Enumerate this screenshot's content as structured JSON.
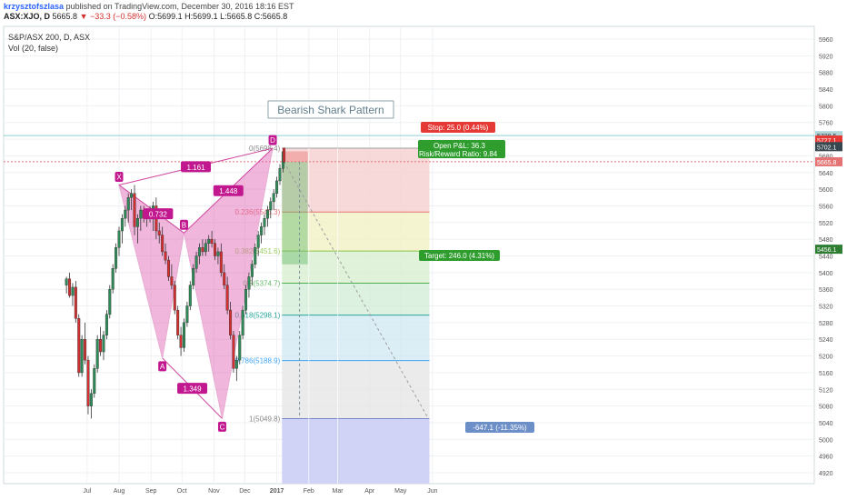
{
  "header": {
    "author": "krzysztofszlasa",
    "published_text": "published on TradingView.com, December 30, 2016 18:16 EST",
    "symbol": "ASX:XJO, D",
    "last": "5665.8",
    "change": "−33.3 (−0.58%)",
    "o": "O:5699.1",
    "h": "H:5699.1",
    "l": "L:5665.8",
    "c": "C:5665.8"
  },
  "legend": {
    "line1": "S&P/ASX 200, D, ASX",
    "line2": "Vol (20, false)"
  },
  "chart_data": {
    "type": "candlestick",
    "title": "Bearish Shark Pattern",
    "x_ticks": [
      "Jul",
      "Aug",
      "Sep",
      "Oct",
      "Nov",
      "Dec",
      "2017",
      "Feb",
      "Mar",
      "Apr",
      "May",
      "Jun"
    ],
    "y_ticks": [
      4920,
      4960,
      5000,
      5040,
      5080,
      5120,
      5160,
      5200,
      5240,
      5280,
      5320,
      5360,
      5400,
      5440,
      5480,
      5520,
      5560,
      5600,
      5640,
      5680,
      5720,
      5760,
      5800,
      5840,
      5880,
      5920,
      5960
    ],
    "ylim": [
      4900,
      5980
    ],
    "pattern_points": [
      {
        "label": "X",
        "date": "2016-08-01",
        "price": 5610
      },
      {
        "label": "A",
        "date": "2016-09-12",
        "price": 5195
      },
      {
        "label": "B",
        "date": "2016-10-03",
        "price": 5495
      },
      {
        "label": "C",
        "date": "2016-11-09",
        "price": 5050
      },
      {
        "label": "D",
        "date": "2016-12-28",
        "price": 5698
      }
    ],
    "ratios": [
      {
        "text": "0.732",
        "between": "X-B"
      },
      {
        "text": "1.161",
        "between": "X-D"
      },
      {
        "text": "1.448",
        "between": "B-D"
      },
      {
        "text": "1.349",
        "between": "A-C"
      }
    ],
    "fib_levels": [
      {
        "label": "0(5698.4)",
        "price": 5698.4
      },
      {
        "label": "0.236(5545.3)",
        "price": 5545.3
      },
      {
        "label": "0.382(5451.6)",
        "price": 5451.6
      },
      {
        "label": "0.5(5374.7)",
        "price": 5374.7
      },
      {
        "label": "0.618(5298.1)",
        "price": 5298.1
      },
      {
        "label": "0.786(5188.9)",
        "price": 5188.9
      },
      {
        "label": "1(5049.8)",
        "price": 5049.8
      }
    ],
    "trade": {
      "stop": "Stop: 25.0 (0.44%)",
      "open_pl": "Open P&L: 36.3",
      "risk_reward": "Risk/Reward Ratio: 9.84",
      "target": "Target: 246.0 (4.31%)",
      "measure": "-647.1 (-11.35%)",
      "entry_price": 5665.8,
      "stop_price": 5690.8,
      "target_price": 5419.8
    },
    "price_labels": [
      {
        "text": "5728.5",
        "price": 5728.5,
        "color": "#b0d4d8"
      },
      {
        "text": "5727.1",
        "price": 5718,
        "color": "#e53935"
      },
      {
        "text": "5702.1",
        "price": 5702,
        "color": "#37474f"
      },
      {
        "text": "5665.8",
        "price": 5665.8,
        "color": "#e57373"
      },
      {
        "text": "5456.1",
        "price": 5456.1,
        "color": "#2e7d32"
      }
    ],
    "candles": [
      [
        -51,
        5370,
        5390,
        5350,
        5385
      ],
      [
        -48,
        5385,
        5400,
        5340,
        5345
      ],
      [
        -45,
        5345,
        5375,
        5320,
        5365
      ],
      [
        -42,
        5365,
        5380,
        5280,
        5290
      ],
      [
        -39,
        5290,
        5300,
        5150,
        5160
      ],
      [
        -36,
        5160,
        5250,
        5150,
        5240
      ],
      [
        -33,
        5240,
        5280,
        5180,
        5190
      ],
      [
        -30,
        5190,
        5200,
        5060,
        5080
      ],
      [
        -27,
        5080,
        5120,
        5050,
        5110
      ],
      [
        -24,
        5110,
        5180,
        5100,
        5170
      ],
      [
        -21,
        5170,
        5250,
        5160,
        5240
      ],
      [
        -18,
        5240,
        5270,
        5200,
        5210
      ],
      [
        -15,
        5210,
        5260,
        5190,
        5250
      ],
      [
        -12,
        5250,
        5310,
        5240,
        5300
      ],
      [
        -9,
        5300,
        5370,
        5290,
        5360
      ],
      [
        -6,
        5360,
        5420,
        5350,
        5410
      ],
      [
        -3,
        5410,
        5470,
        5400,
        5460
      ],
      [
        0,
        5460,
        5510,
        5440,
        5500
      ],
      [
        3,
        5500,
        5540,
        5470,
        5530
      ],
      [
        6,
        5530,
        5560,
        5510,
        5550
      ],
      [
        9,
        5550,
        5590,
        5520,
        5580
      ],
      [
        12,
        5580,
        5600,
        5550,
        5590
      ],
      [
        15,
        5590,
        5610,
        5490,
        5510
      ],
      [
        18,
        5510,
        5540,
        5470,
        5530
      ],
      [
        21,
        5530,
        5560,
        5500,
        5550
      ],
      [
        24,
        5550,
        5560,
        5520,
        5530
      ],
      [
        27,
        5530,
        5550,
        5510,
        5540
      ],
      [
        30,
        5540,
        5560,
        5520,
        5530
      ],
      [
        33,
        5530,
        5570,
        5500,
        5560
      ],
      [
        36,
        5560,
        5580,
        5480,
        5500
      ],
      [
        39,
        5500,
        5520,
        5470,
        5490
      ],
      [
        42,
        5490,
        5510,
        5440,
        5450
      ],
      [
        45,
        5450,
        5470,
        5420,
        5430
      ],
      [
        48,
        5430,
        5440,
        5380,
        5390
      ],
      [
        51,
        5390,
        5420,
        5360,
        5370
      ],
      [
        54,
        5370,
        5380,
        5300,
        5310
      ],
      [
        57,
        5310,
        5320,
        5240,
        5250
      ],
      [
        60,
        5250,
        5270,
        5200,
        5220
      ],
      [
        63,
        5220,
        5290,
        5210,
        5280
      ],
      [
        66,
        5280,
        5330,
        5270,
        5320
      ],
      [
        69,
        5320,
        5380,
        5310,
        5370
      ],
      [
        72,
        5370,
        5420,
        5360,
        5410
      ],
      [
        75,
        5410,
        5450,
        5400,
        5440
      ],
      [
        78,
        5440,
        5470,
        5420,
        5460
      ],
      [
        81,
        5460,
        5480,
        5440,
        5450
      ],
      [
        84,
        5450,
        5480,
        5440,
        5470
      ],
      [
        87,
        5470,
        5490,
        5450,
        5480
      ],
      [
        90,
        5480,
        5500,
        5460,
        5470
      ],
      [
        93,
        5470,
        5480,
        5430,
        5440
      ],
      [
        96,
        5440,
        5460,
        5420,
        5450
      ],
      [
        99,
        5450,
        5470,
        5390,
        5400
      ],
      [
        102,
        5400,
        5420,
        5360,
        5370
      ],
      [
        105,
        5370,
        5390,
        5300,
        5310
      ],
      [
        108,
        5310,
        5330,
        5240,
        5250
      ],
      [
        111,
        5250,
        5260,
        5160,
        5170
      ],
      [
        114,
        5170,
        5200,
        5140,
        5190
      ],
      [
        117,
        5190,
        5260,
        5180,
        5250
      ],
      [
        120,
        5250,
        5320,
        5240,
        5310
      ],
      [
        123,
        5310,
        5370,
        5300,
        5360
      ],
      [
        126,
        5360,
        5400,
        5340,
        5390
      ],
      [
        129,
        5390,
        5430,
        5370,
        5420
      ],
      [
        132,
        5420,
        5470,
        5410,
        5460
      ],
      [
        135,
        5460,
        5500,
        5440,
        5490
      ],
      [
        138,
        5490,
        5520,
        5470,
        5510
      ],
      [
        141,
        5510,
        5540,
        5490,
        5530
      ],
      [
        144,
        5530,
        5560,
        5510,
        5550
      ],
      [
        147,
        5550,
        5580,
        5530,
        5570
      ],
      [
        150,
        5570,
        5600,
        5550,
        5590
      ],
      [
        153,
        5590,
        5630,
        5580,
        5620
      ],
      [
        156,
        5620,
        5660,
        5610,
        5650
      ],
      [
        159,
        5650,
        5699,
        5640,
        5690
      ],
      [
        160,
        5699,
        5699,
        5665,
        5665
      ]
    ]
  }
}
